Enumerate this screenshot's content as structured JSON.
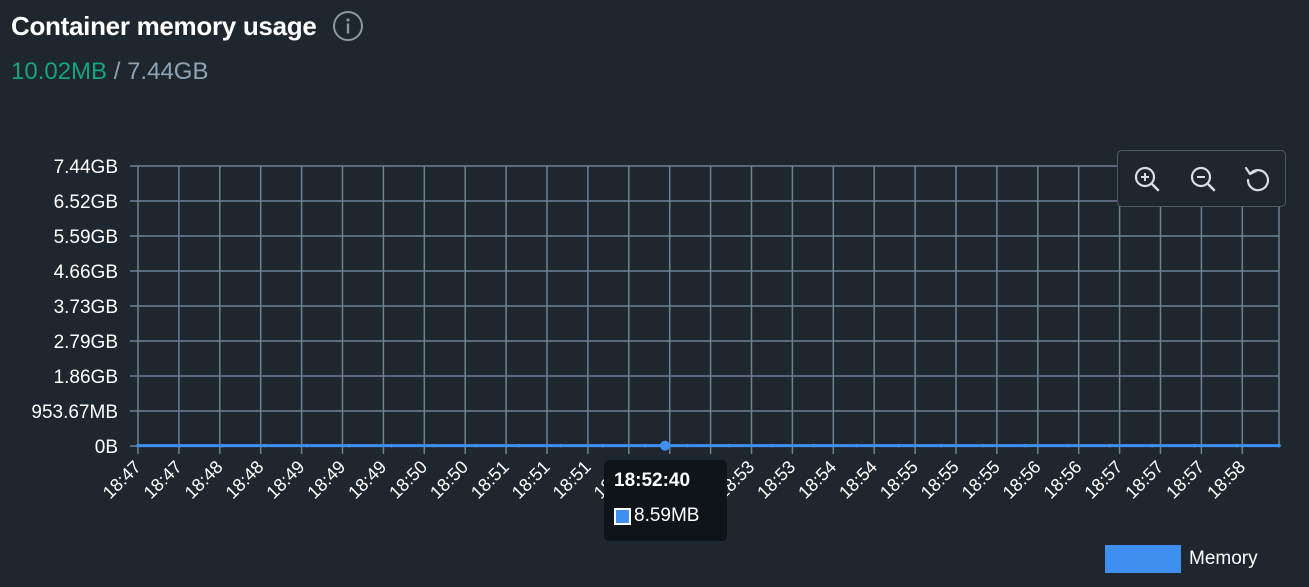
{
  "header": {
    "title": "Container memory usage",
    "info_icon": "info-icon",
    "current_usage": "10.02MB",
    "separator": "/",
    "total_memory": "7.44GB"
  },
  "toolbar": {
    "zoom_in_icon": "zoom-in-icon",
    "zoom_out_icon": "zoom-out-icon",
    "reset_icon": "reset-icon"
  },
  "tooltip": {
    "time": "18:52:40",
    "value": "8.59MB"
  },
  "colors": {
    "background": "#1e262e",
    "current_usage": "#14a37f",
    "total_memory": "#8fa3b6",
    "series": "#3f8ff0",
    "grid": "#6c8196"
  },
  "chart_data": {
    "type": "area",
    "title": "Container memory usage",
    "ylabel": "",
    "xlabel": "",
    "ylim": [
      0,
      7.44
    ],
    "y_unit": "GB",
    "yticks": [
      "0B",
      "953.67MB",
      "1.86GB",
      "2.79GB",
      "3.73GB",
      "4.66GB",
      "5.59GB",
      "6.52GB",
      "7.44GB"
    ],
    "x": [
      "18:47",
      "18:47",
      "18:48",
      "18:48",
      "18:49",
      "18:49",
      "18:49",
      "18:50",
      "18:50",
      "18:51",
      "18:51",
      "18:51",
      "18:52",
      "18:52",
      "18:53",
      "18:53",
      "18:53",
      "18:54",
      "18:54",
      "18:55",
      "18:55",
      "18:55",
      "18:56",
      "18:56",
      "18:57",
      "18:57",
      "18:57",
      "18:58"
    ],
    "legend": "bottom-right",
    "grid": true,
    "series": [
      {
        "name": "Memory",
        "values": [
          0.0098,
          0.0098,
          0.0098,
          0.0098,
          0.0098,
          0.0098,
          0.0098,
          0.0098,
          0.0098,
          0.0098,
          0.0098,
          0.0098,
          0.0098,
          0.0098,
          0.0098,
          0.0098,
          0.0098,
          0.0098,
          0.0098,
          0.0098,
          0.0098,
          0.0098,
          0.0098,
          0.0098,
          0.0098,
          0.0098,
          0.0098,
          0.0098
        ]
      }
    ],
    "highlight": {
      "x": "18:52:40",
      "value": "8.59MB"
    }
  }
}
